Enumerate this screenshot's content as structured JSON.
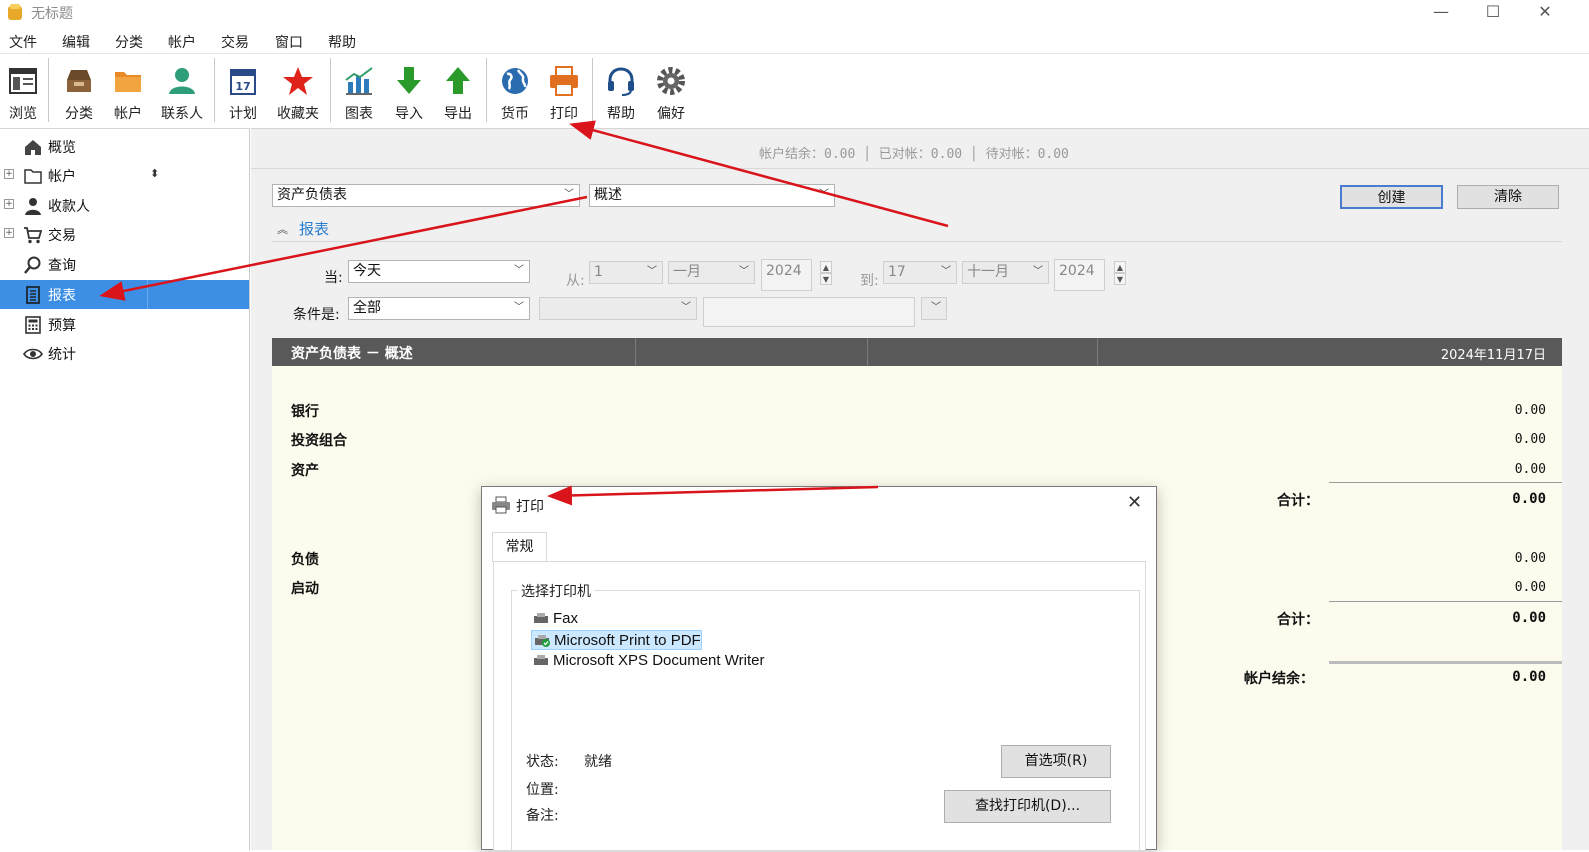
{
  "window": {
    "title": "无标题",
    "minimize": "—",
    "maximize": "☐",
    "close": "✕"
  },
  "menu": [
    "文件",
    "编辑",
    "分类",
    "帐户",
    "交易",
    "窗口",
    "帮助"
  ],
  "toolbar": {
    "browse": "浏览",
    "categories": "分类",
    "accounts": "帐户",
    "contacts": "联系人",
    "schedule": "计划",
    "favorites": "收藏夹",
    "charts": "图表",
    "import": "导入",
    "export": "导出",
    "currency": "货币",
    "print": "打印",
    "help": "帮助",
    "preferences": "偏好",
    "calendar_day": "17"
  },
  "sidebar": {
    "items": [
      {
        "label": "概览",
        "icon": "home-icon"
      },
      {
        "label": "帐户",
        "icon": "folder-icon"
      },
      {
        "label": "收款人",
        "icon": "person-icon"
      },
      {
        "label": "交易",
        "icon": "cart-icon"
      },
      {
        "label": "查询",
        "icon": "search-icon"
      },
      {
        "label": "报表",
        "icon": "report-icon"
      },
      {
        "label": "预算",
        "icon": "calculator-icon"
      },
      {
        "label": "统计",
        "icon": "eye-icon"
      }
    ],
    "sort_glyph": "⬍"
  },
  "status": {
    "text": "帐户结余：0.00 │ 已对帐：0.00 │ 待对帐：0.00"
  },
  "report_controls": {
    "report_type": "资产负债表",
    "report_subtype": "概述",
    "create_button": "创建",
    "clear_button": "清除",
    "section_title": "报表",
    "when_label": "当:",
    "when_value": "今天",
    "from_label": "从:",
    "from_day": "1",
    "from_month": "一月",
    "from_year": "2024",
    "to_label": "到:",
    "to_day": "17",
    "to_month": "十一月",
    "to_year": "2024",
    "condition_label": "条件是:",
    "condition_value": "全部"
  },
  "report": {
    "header_title": "资产负债表 － 概述",
    "header_date": "2024年11月17日",
    "rows": [
      {
        "label": "银行",
        "value": "0.00"
      },
      {
        "label": "投资组合",
        "value": "0.00"
      },
      {
        "label": "资产",
        "value": "0.00"
      },
      {
        "label": "合计：",
        "value": "0.00"
      },
      {
        "label": "负债",
        "value": "0.00"
      },
      {
        "label": "启动",
        "value": "0.00"
      },
      {
        "label": "合计：",
        "value": "0.00"
      },
      {
        "label": "帐户结余：",
        "value": "0.00"
      }
    ]
  },
  "print_dialog": {
    "title": "打印",
    "tab": "常规",
    "group_title": "选择打印机",
    "printers": [
      "Fax",
      "Microsoft Print to PDF",
      "Microsoft XPS Document Writer"
    ],
    "selected_printer": "Microsoft Print to PDF",
    "status_label": "状态:",
    "status_value": "就绪",
    "location_label": "位置:",
    "comment_label": "备注:",
    "preferences_button": "首选项(R)",
    "find_printer_button": "查找打印机(D)...",
    "close": "✕"
  },
  "colors": {
    "accent": "#3d8fe6",
    "report_bg": "#fdfbed",
    "report_header": "#595959",
    "annotation_arrow": "#d9141b"
  }
}
